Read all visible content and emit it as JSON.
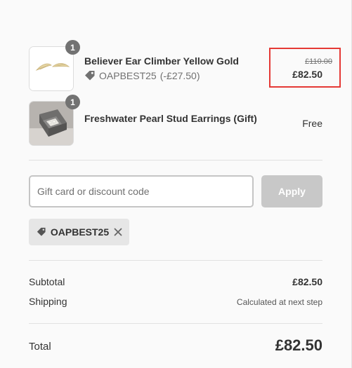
{
  "items": [
    {
      "name": "Believer Ear Climber Yellow Gold",
      "quantity": "1",
      "discount_code": "OAPBEST25",
      "discount_amount": "(-£27.50)",
      "original_price": "£110.00",
      "price": "£82.50",
      "thumbnail_icon": "ear-climber-earring-image"
    },
    {
      "name": "Freshwater Pearl Stud Earrings (Gift)",
      "quantity": "1",
      "price": "Free",
      "thumbnail_icon": "pearl-earrings-gift-box-image"
    }
  ],
  "discount": {
    "placeholder": "Gift card or discount code",
    "value": "",
    "apply_label": "Apply",
    "applied_code": "OAPBEST25"
  },
  "summary": {
    "subtotal_label": "Subtotal",
    "subtotal_value": "£82.50",
    "shipping_label": "Shipping",
    "shipping_value": "Calculated at next step",
    "total_label": "Total",
    "total_value": "£82.50"
  },
  "colors": {
    "highlight_border": "#e53935",
    "badge": "#727272",
    "apply_button": "#c8c8c8"
  }
}
